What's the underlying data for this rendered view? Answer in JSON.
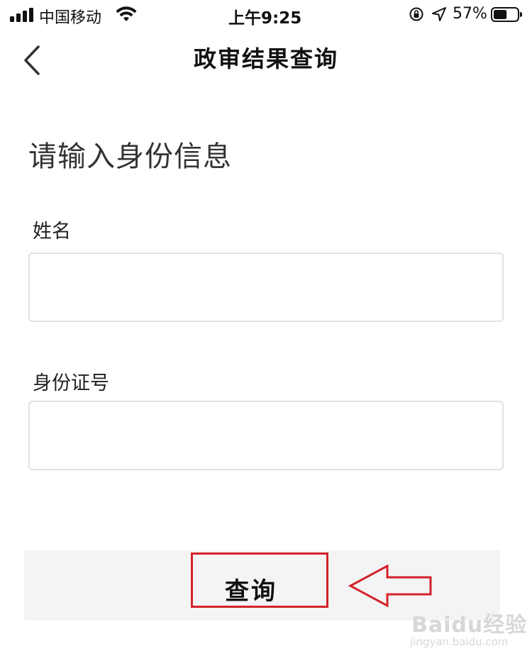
{
  "status_bar": {
    "carrier": "中国移动",
    "time": "上午9:25",
    "battery_percent": "57%",
    "battery_level": 0.57,
    "icons": [
      "signal-icon",
      "wifi-icon",
      "orientation-lock-icon",
      "location-icon",
      "battery-icon"
    ]
  },
  "nav": {
    "title": "政审结果查询",
    "back_icon": "chevron-left-icon"
  },
  "form": {
    "heading": "请输入身份信息",
    "name_label": "姓名",
    "name_value": "",
    "id_label": "身份证号",
    "id_value": "",
    "submit_label": "查询"
  },
  "annotation": {
    "highlight_color": "#d3222a",
    "arrow_icon": "left-arrow-icon"
  },
  "watermark": {
    "text": "Baidu经验",
    "url": "jingyan.baidu.com"
  }
}
